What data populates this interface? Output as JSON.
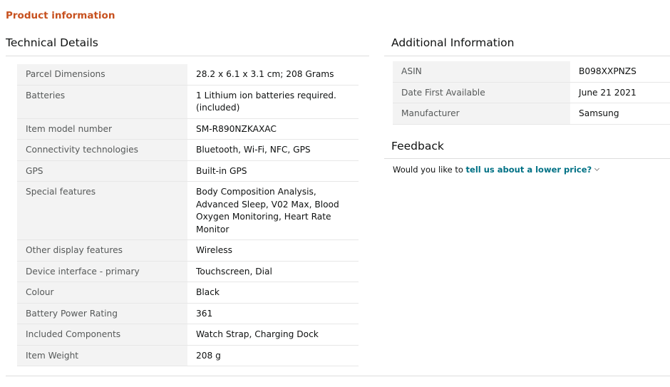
{
  "section_title": "Product information",
  "technical_details": {
    "heading": "Technical Details",
    "rows": [
      {
        "label": "Parcel Dimensions",
        "value": "28.2 x 6.1 x 3.1 cm; 208 Grams"
      },
      {
        "label": "Batteries",
        "value": "1 Lithium ion batteries required. (included)"
      },
      {
        "label": "Item model number",
        "value": "SM-R890NZKAXAC"
      },
      {
        "label": "Connectivity technologies",
        "value": "Bluetooth, Wi-Fi, NFC, GPS"
      },
      {
        "label": "GPS",
        "value": "Built-in GPS"
      },
      {
        "label": "Special features",
        "value": "Body Composition Analysis, Advanced Sleep, V02 Max, Blood Oxygen Monitoring, Heart Rate Monitor"
      },
      {
        "label": "Other display features",
        "value": "Wireless"
      },
      {
        "label": "Device interface - primary",
        "value": "Touchscreen, Dial"
      },
      {
        "label": "Colour",
        "value": "Black"
      },
      {
        "label": "Battery Power Rating",
        "value": "361"
      },
      {
        "label": "Included Components",
        "value": "Watch Strap, Charging Dock"
      },
      {
        "label": "Item Weight",
        "value": "208 g"
      }
    ]
  },
  "additional_information": {
    "heading": "Additional Information",
    "rows": [
      {
        "label": "ASIN",
        "value": "B098XXPNZS"
      },
      {
        "label": "Date First Available",
        "value": "June 21 2021"
      },
      {
        "label": "Manufacturer",
        "value": "Samsung"
      }
    ]
  },
  "feedback": {
    "heading": "Feedback",
    "prompt": "Would you like to ",
    "link_text": "tell us about a lower price?",
    "chevron_icon": "chevron-down-icon"
  },
  "colors": {
    "section_title": "#c7511f",
    "link": "#007185",
    "label_background": "#f3f3f3"
  }
}
